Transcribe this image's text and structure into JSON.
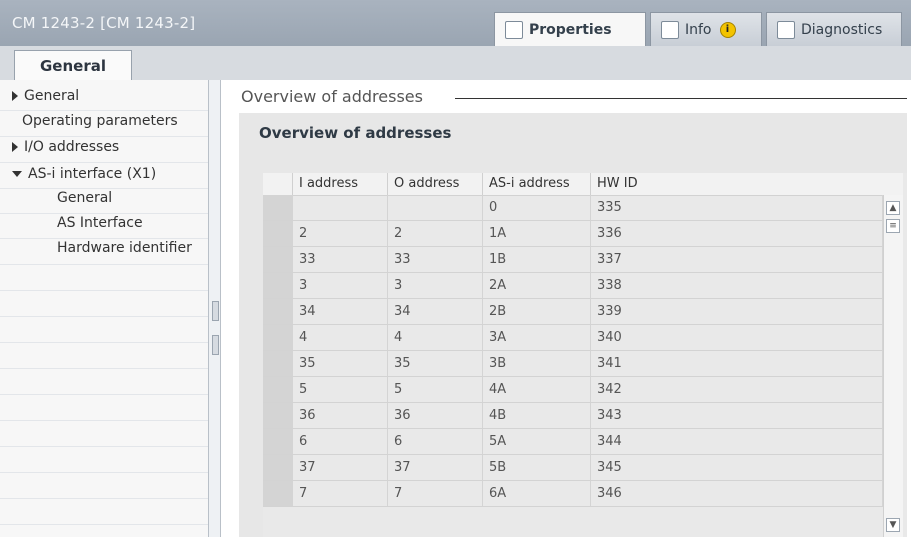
{
  "window": {
    "title": "CM 1243-2 [CM 1243-2]",
    "top_tabs": [
      {
        "label": "Properties",
        "icon": "properties-icon",
        "active": true
      },
      {
        "label": "Info",
        "icon": "info-icon",
        "active": false,
        "badge": "i"
      },
      {
        "label": "Diagnostics",
        "icon": "diagnostics-icon",
        "active": false
      }
    ]
  },
  "subtabs": {
    "general": "General"
  },
  "nav": {
    "items": [
      {
        "label": "General",
        "level": 0,
        "expander": "right"
      },
      {
        "label": "Operating parameters",
        "level": 0,
        "expander": "none"
      },
      {
        "label": "I/O addresses",
        "level": 0,
        "expander": "right",
        "selected": true
      },
      {
        "label": "AS-i interface (X1)",
        "level": 0,
        "expander": "down"
      },
      {
        "label": "General",
        "level": 1,
        "expander": "none"
      },
      {
        "label": "AS Interface",
        "level": 1,
        "expander": "none"
      },
      {
        "label": "Hardware identifier",
        "level": 1,
        "expander": "none"
      }
    ]
  },
  "content": {
    "section_heading": "Overview of addresses",
    "panel_title": "Overview of addresses",
    "table": {
      "headers": [
        "I address",
        "O address",
        "AS-i address",
        "HW ID"
      ],
      "rows": [
        [
          "",
          "",
          "0",
          "335"
        ],
        [
          "2",
          "2",
          "1A",
          "336"
        ],
        [
          "33",
          "33",
          "1B",
          "337"
        ],
        [
          "3",
          "3",
          "2A",
          "338"
        ],
        [
          "34",
          "34",
          "2B",
          "339"
        ],
        [
          "4",
          "4",
          "3A",
          "340"
        ],
        [
          "35",
          "35",
          "3B",
          "341"
        ],
        [
          "5",
          "5",
          "4A",
          "342"
        ],
        [
          "36",
          "36",
          "4B",
          "343"
        ],
        [
          "6",
          "6",
          "5A",
          "344"
        ],
        [
          "37",
          "37",
          "5B",
          "345"
        ],
        [
          "7",
          "7",
          "6A",
          "346"
        ]
      ]
    },
    "scrollbar": {
      "up": "▲",
      "thumb": "≡",
      "down": "▼"
    }
  }
}
